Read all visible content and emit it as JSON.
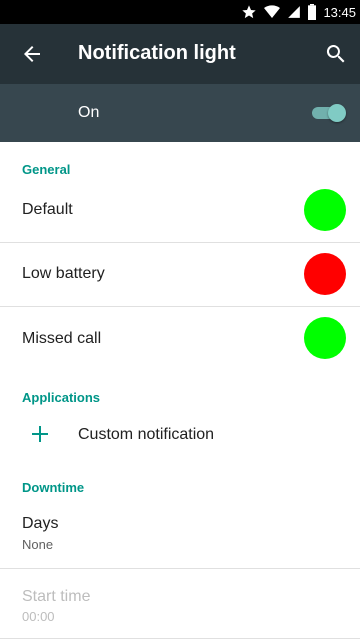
{
  "status_bar": {
    "time": "13:45"
  },
  "app_bar": {
    "title": "Notification light"
  },
  "master": {
    "label": "On",
    "enabled": true,
    "accent": "#80cbc4"
  },
  "sections": {
    "general": "General",
    "applications": "Applications",
    "downtime": "Downtime"
  },
  "general_items": [
    {
      "label": "Default",
      "color": "#00ff00"
    },
    {
      "label": "Low battery",
      "color": "#ff0000"
    },
    {
      "label": "Missed call",
      "color": "#00ff00"
    }
  ],
  "applications": {
    "custom_label": "Custom notification",
    "icon": "plus-icon"
  },
  "downtime": {
    "days_label": "Days",
    "days_value": "None",
    "start_label": "Start time",
    "start_value": "00:00"
  },
  "colors": {
    "app_bar": "#263238",
    "master_bar": "#37474f",
    "accent": "#009688"
  }
}
